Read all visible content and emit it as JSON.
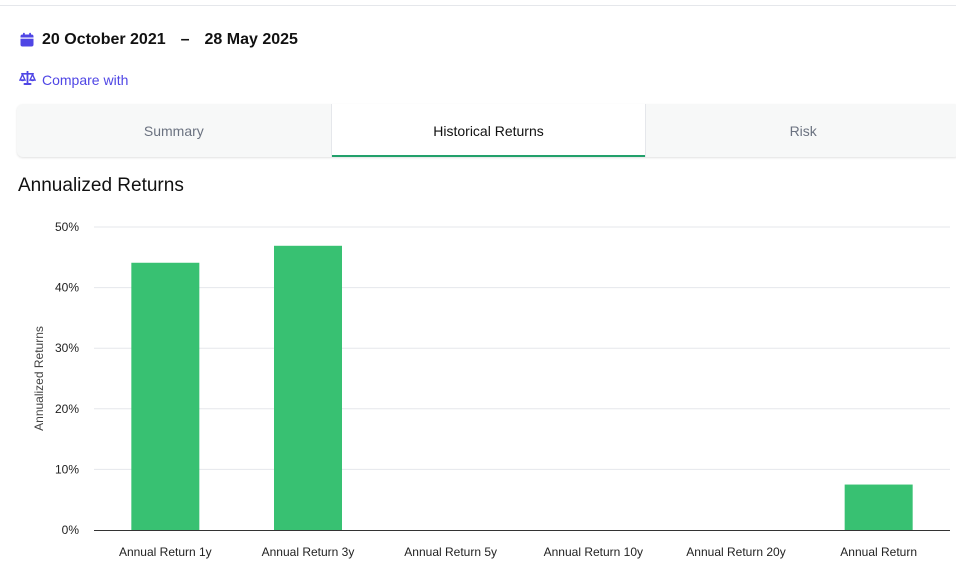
{
  "date_range": {
    "start": "20 October 2021",
    "separator": "–",
    "end": "28 May 2025"
  },
  "compare": {
    "label": "Compare with",
    "icon": "scale-icon"
  },
  "tabs": [
    {
      "label": "Summary",
      "active": false
    },
    {
      "label": "Historical Returns",
      "active": true
    },
    {
      "label": "Risk",
      "active": false
    }
  ],
  "section": {
    "title": "Annualized Returns"
  },
  "colors": {
    "accent": "#4f46e5",
    "bar": "#38c172",
    "tab_underline": "#22a06b",
    "grid": "#e5e7eb"
  },
  "chart_data": {
    "type": "bar",
    "ylabel": "Annualized Returns",
    "xlabel": "",
    "ylim": [
      0,
      50
    ],
    "y_ticks": [
      "0%",
      "10%",
      "20%",
      "30%",
      "40%",
      "50%"
    ],
    "y_tick_values": [
      0,
      10,
      20,
      30,
      40,
      50
    ],
    "categories": [
      "Annual Return 1y",
      "Annual Return 3y",
      "Annual Return 5y",
      "Annual Return 10y",
      "Annual Return 20y",
      "Annual Return"
    ],
    "values": [
      44.1,
      46.9,
      null,
      null,
      null,
      7.5
    ],
    "grid": true
  }
}
